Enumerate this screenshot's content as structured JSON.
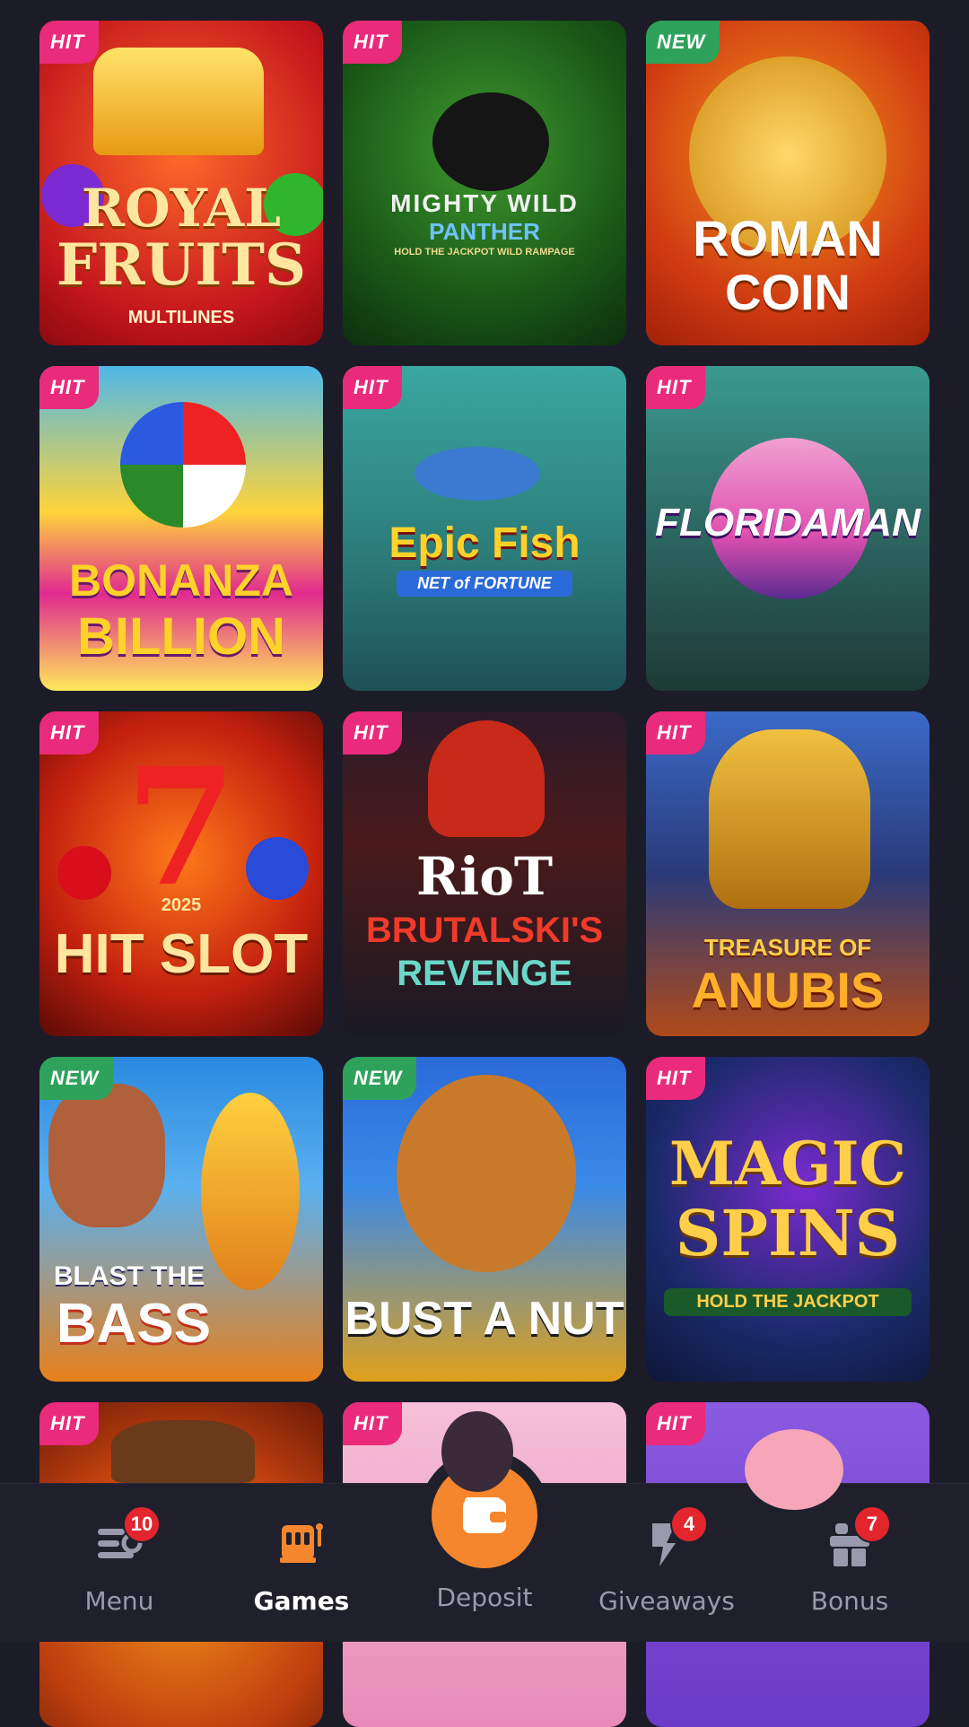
{
  "games": [
    {
      "badge": "HIT",
      "title1": "ROYAL",
      "title2": "FRUITS",
      "title3": "MULTILINES"
    },
    {
      "badge": "HIT",
      "title1": "MIGHTY WILD",
      "title2": "PANTHER",
      "title3": "HOLD THE JACKPOT WILD RAMPAGE"
    },
    {
      "badge": "NEW",
      "title1": "ROMAN",
      "title2": "COIN",
      "title3": ""
    },
    {
      "badge": "HIT",
      "title1": "BONANZA",
      "title2": "BILLION",
      "title3": ""
    },
    {
      "badge": "HIT",
      "title1": "Epic Fish",
      "title2": "NET of FORTUNE",
      "title3": ""
    },
    {
      "badge": "HIT",
      "title1": "FLORIDAMAN",
      "title2": "",
      "title3": ""
    },
    {
      "badge": "HIT",
      "title1": "2025",
      "title2": "HIT SLOT",
      "title3": ""
    },
    {
      "badge": "HIT",
      "title1": "RioT",
      "title2": "BRUTALSKI'S",
      "title3": "REVENGE"
    },
    {
      "badge": "HIT",
      "title1": "TREASURE OF",
      "title2": "ANUBIS",
      "title3": ""
    },
    {
      "badge": "NEW",
      "title1": "BLAST THE",
      "title2": "BASS",
      "title3": ""
    },
    {
      "badge": "NEW",
      "title1": "BUST A NUT",
      "title2": "",
      "title3": ""
    },
    {
      "badge": "HIT",
      "title1": "MAGIC",
      "title2": "SPINS",
      "title3": "HOLD THE JACKPOT"
    },
    {
      "badge": "HIT",
      "title1": "",
      "title2": "",
      "title3": ""
    },
    {
      "badge": "HIT",
      "title1": "",
      "title2": "",
      "title3": ""
    },
    {
      "badge": "HIT",
      "title1": "",
      "title2": "",
      "title3": ""
    }
  ],
  "nav": {
    "menu": {
      "label": "Menu",
      "count": "10",
      "icon": "menu-icon"
    },
    "games": {
      "label": "Games",
      "icon": "slot-machine-icon"
    },
    "deposit": {
      "label": "Deposit",
      "icon": "wallet-icon"
    },
    "giveaways": {
      "label": "Giveaways",
      "count": "4",
      "icon": "giveaway-icon"
    },
    "bonus": {
      "label": "Bonus",
      "count": "7",
      "icon": "gift-icon"
    }
  },
  "colors": {
    "hit": "#ea2a7b",
    "new": "#2ea25a",
    "deposit": "#f5862d",
    "count": "#e3262e"
  }
}
